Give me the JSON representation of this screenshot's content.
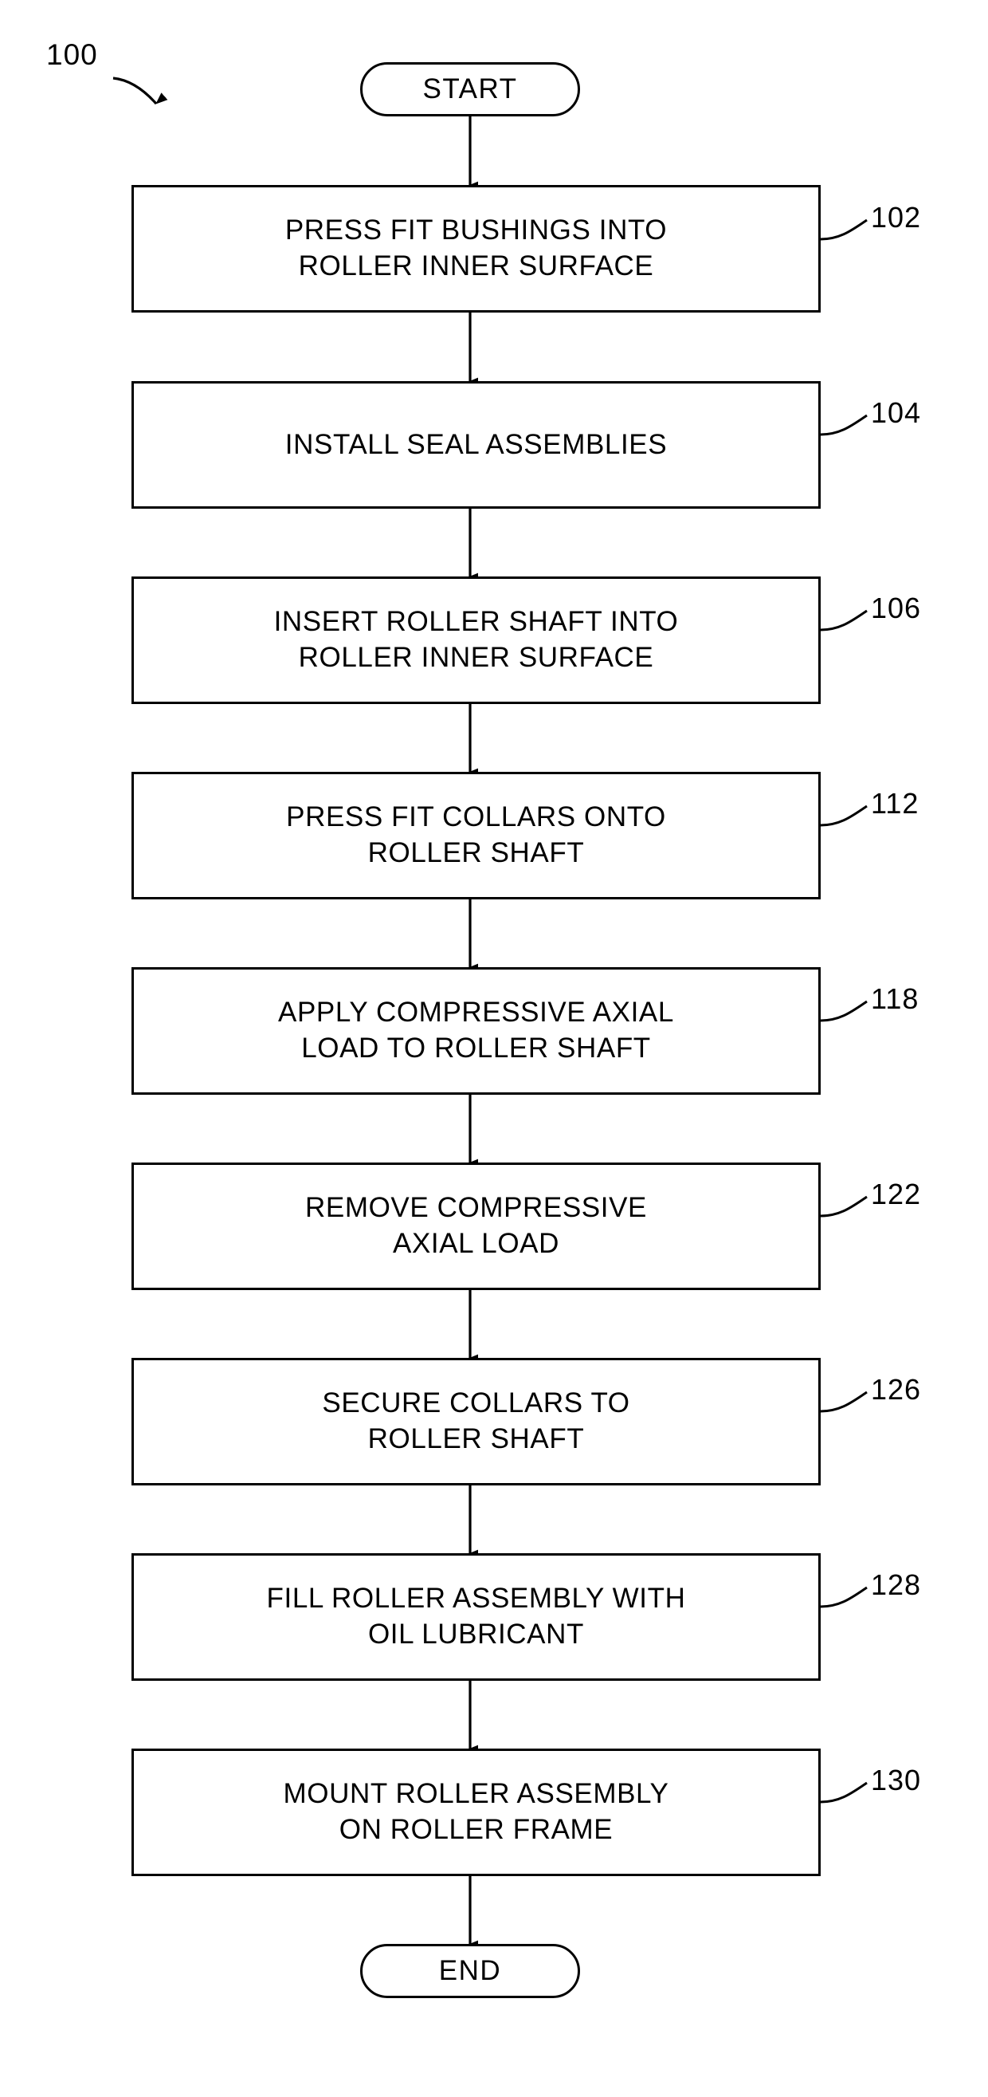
{
  "figure": {
    "reference_number": "100",
    "type": "process-flowchart"
  },
  "nodes": {
    "start": {
      "label": "START"
    },
    "end": {
      "label": "END"
    }
  },
  "steps": [
    {
      "ref": "102",
      "lines": [
        "PRESS FIT BUSHINGS INTO",
        "ROLLER INNER SURFACE"
      ],
      "text": "PRESS FIT BUSHINGS INTO ROLLER INNER SURFACE"
    },
    {
      "ref": "104",
      "lines": [
        "INSTALL SEAL ASSEMBLIES"
      ],
      "text": "INSTALL SEAL ASSEMBLIES"
    },
    {
      "ref": "106",
      "lines": [
        "INSERT ROLLER SHAFT INTO",
        "ROLLER INNER SURFACE"
      ],
      "text": "INSERT ROLLER SHAFT INTO ROLLER INNER SURFACE"
    },
    {
      "ref": "112",
      "lines": [
        "PRESS FIT COLLARS ONTO",
        "ROLLER SHAFT"
      ],
      "text": "PRESS FIT COLLARS ONTO ROLLER SHAFT"
    },
    {
      "ref": "118",
      "lines": [
        "APPLY COMPRESSIVE AXIAL",
        "LOAD TO ROLLER SHAFT"
      ],
      "text": "APPLY COMPRESSIVE AXIAL LOAD TO ROLLER SHAFT"
    },
    {
      "ref": "122",
      "lines": [
        "REMOVE COMPRESSIVE",
        "AXIAL LOAD"
      ],
      "text": "REMOVE COMPRESSIVE AXIAL LOAD"
    },
    {
      "ref": "126",
      "lines": [
        "SECURE COLLARS TO",
        "ROLLER SHAFT"
      ],
      "text": "SECURE COLLARS TO ROLLER SHAFT"
    },
    {
      "ref": "128",
      "lines": [
        "FILL ROLLER ASSEMBLY WITH",
        "OIL LUBRICANT"
      ],
      "text": "FILL ROLLER ASSEMBLY WITH OIL LUBRICANT"
    },
    {
      "ref": "130",
      "lines": [
        "MOUNT ROLLER ASSEMBLY",
        "ON ROLLER FRAME"
      ],
      "text": "MOUNT ROLLER ASSEMBLY ON ROLLER FRAME"
    }
  ],
  "colors": {
    "stroke": "#000000",
    "background": "#ffffff",
    "text": "#000000"
  }
}
